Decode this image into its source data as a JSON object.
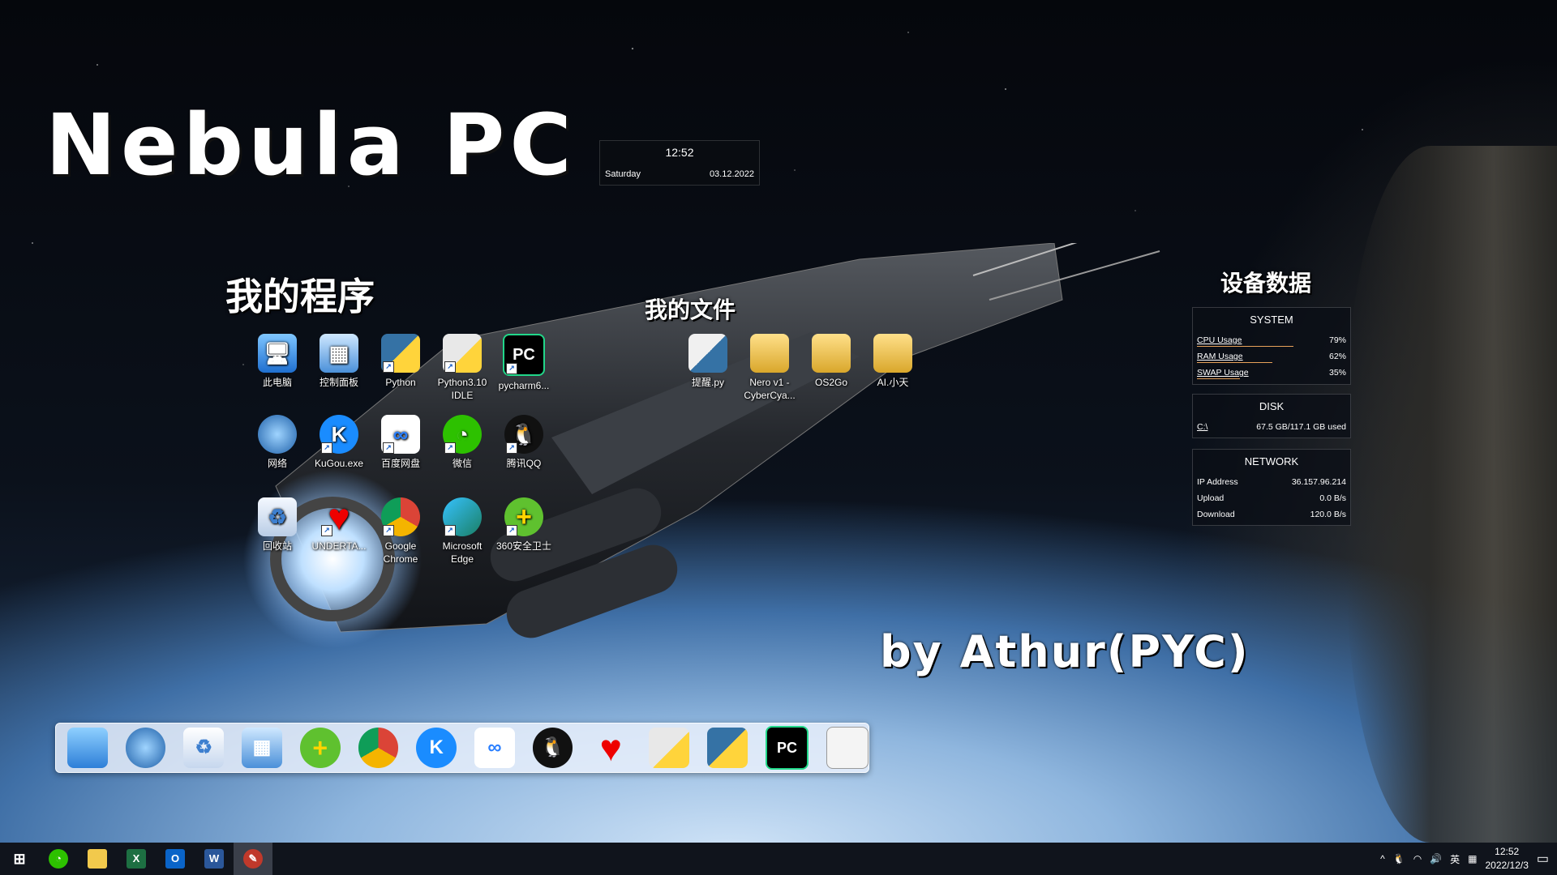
{
  "wallpaper": {
    "big_title": "Nebula PC",
    "signature": "by Athur(PYC)"
  },
  "sections": {
    "programs": "我的程序",
    "files": "我的文件",
    "device": "设备数据"
  },
  "clock_widget": {
    "time": "12:52",
    "day": "Saturday",
    "date": "03.12.2022"
  },
  "system_widget": {
    "title": "SYSTEM",
    "rows": [
      {
        "label": "CPU Usage",
        "value": "79%",
        "level": 0.79
      },
      {
        "label": "RAM Usage",
        "value": "62%",
        "level": 0.62
      },
      {
        "label": "SWAP Usage",
        "value": "35%",
        "level": 0.35
      }
    ]
  },
  "disk_widget": {
    "title": "DISK",
    "drive": "C:\\",
    "usage": "67.5 GB/117.1 GB used"
  },
  "network_widget": {
    "title": "NETWORK",
    "rows": [
      {
        "label": "IP Address",
        "value": "36.157.96.214"
      },
      {
        "label": "Upload",
        "value": "0.0 B/s"
      },
      {
        "label": "Download",
        "value": "120.0 B/s"
      }
    ]
  },
  "desktop_icons": {
    "this_pc": "此电脑",
    "control_panel": "控制面板",
    "python": "Python",
    "python_idle": "Python3.10 IDLE",
    "pycharm": "pycharm6...",
    "network": "网络",
    "kugou": "KuGou.exe",
    "baidu_netdisk": "百度网盘",
    "wechat": "微信",
    "qq": "腾讯QQ",
    "recycle_bin": "回收站",
    "undertale": "UNDERTA...",
    "chrome": "Google Chrome",
    "edge": "Microsoft Edge",
    "safe360": "360安全卫士",
    "remind_py": "提醒.py",
    "nero": "Nero v1 - CyberCya...",
    "os2go": "OS2Go",
    "ai_xiaotian": "AI.小天"
  },
  "dock_items": [
    "this-pc-icon",
    "network-icon",
    "recycle-bin-icon",
    "control-panel-icon",
    "360-icon",
    "chrome-icon",
    "kugou-icon",
    "baidu-netdisk-icon",
    "qq-icon",
    "undertale-heart-icon",
    "python-idle-icon",
    "python-icon",
    "pycharm-icon",
    "window-preview-icon"
  ],
  "taskbar": {
    "ime": "英",
    "clock_time": "12:52",
    "clock_date": "2022/12/3"
  },
  "colors": {
    "bar_accent": "#e8a25a",
    "widget_bg": "#0a0e16",
    "taskbar_bg": "#10141c"
  }
}
